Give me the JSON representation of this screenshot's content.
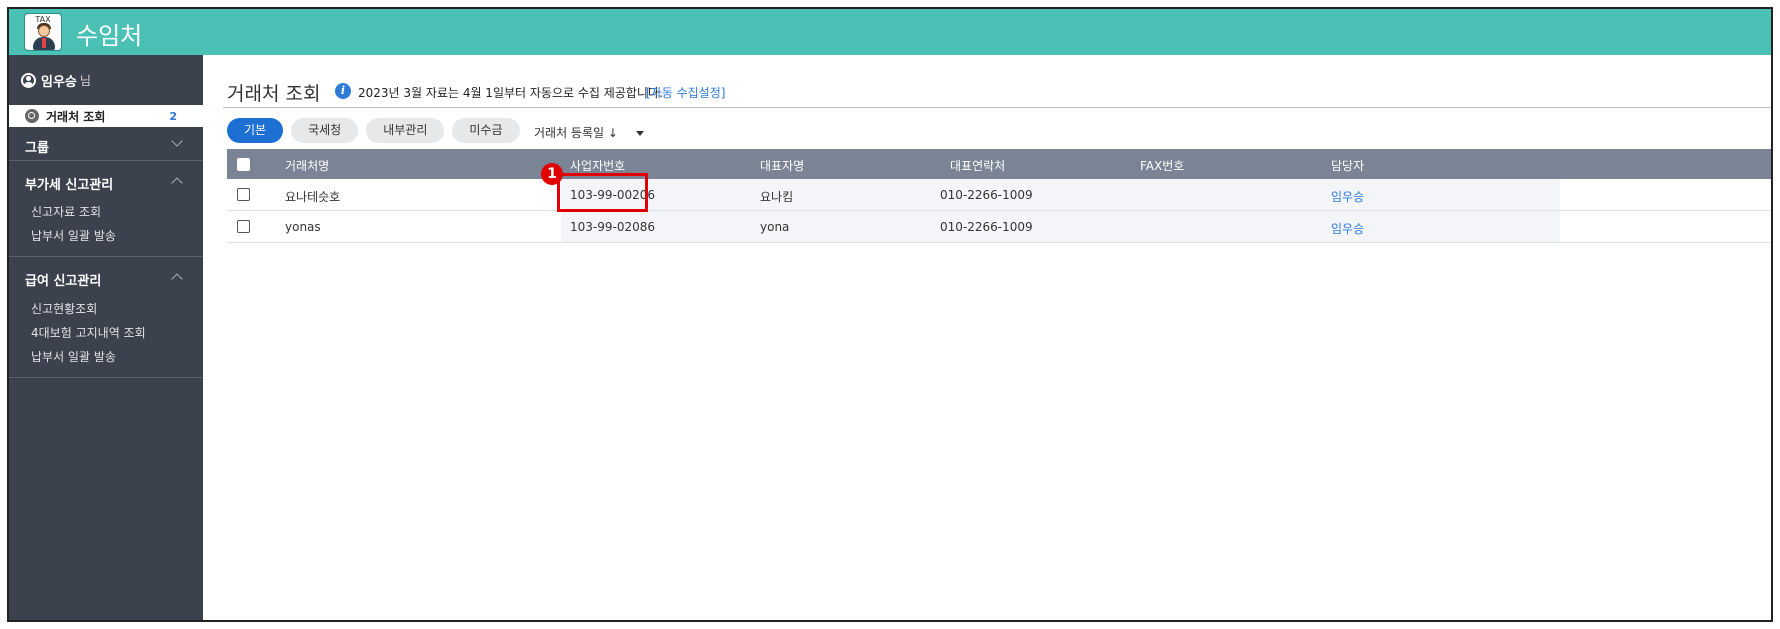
{
  "header": {
    "app_title": "수임처",
    "logo_text": "TAX"
  },
  "sidebar": {
    "user_name": "임우승",
    "user_suffix": "님",
    "active_item": {
      "label": "거래처 조회",
      "count": "2"
    },
    "groups": [
      {
        "label": "그룹",
        "expanded": false,
        "items": []
      },
      {
        "label": "부가세 신고관리",
        "expanded": true,
        "items": [
          "신고자료 조회",
          "납부서 일괄 발송"
        ]
      },
      {
        "label": "급여 신고관리",
        "expanded": true,
        "items": [
          "신고현황조회",
          "4대보험 고지내역 조회",
          "납부서 일괄 발송"
        ]
      }
    ]
  },
  "main": {
    "title": "거래처 조회",
    "notice": "2023년 3월 자료는 4월 1일부터 자동으로 수집 제공합니다.",
    "notice_link": "[자동 수집설정]",
    "tabs": [
      "기본",
      "국세청",
      "내부관리",
      "미수금"
    ],
    "sort_label": "거래처 등록일 ↓",
    "table": {
      "headers": [
        "거래처명",
        "사업자번호",
        "대표자명",
        "대표연락처",
        "FAX번호",
        "담당자"
      ],
      "rows": [
        [
          "요나테슷호",
          "103-99-00206",
          "요나킴",
          "010-2266-1009",
          "",
          "임우승"
        ],
        [
          "yonas",
          "103-99-02086",
          "yona",
          "010-2266-1009",
          "",
          "임우승"
        ]
      ]
    }
  },
  "annotation": {
    "badge": "1"
  },
  "colors": {
    "header": "#4bc1b6",
    "sidebar": "#3b424d",
    "accent": "#1d6fd1",
    "callout": "#e00000"
  }
}
